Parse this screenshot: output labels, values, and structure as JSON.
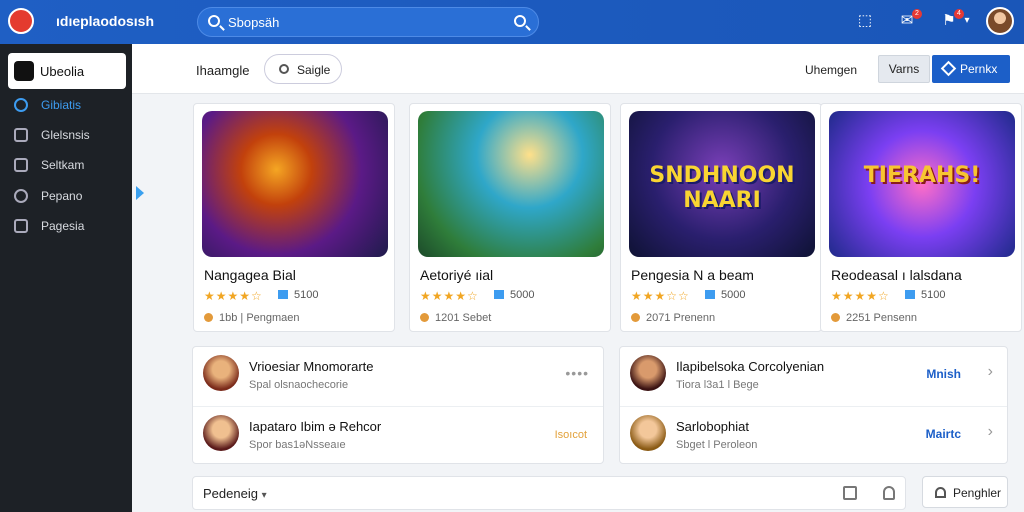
{
  "topbar": {
    "app_name": "ıdıeplaodosısh",
    "search_placeholder": "Sbopsäh",
    "notif_badge": "2",
    "notif_badge2": "4"
  },
  "sidebar": {
    "header_label": "Ubeolia",
    "items": [
      {
        "label": "Gibiatis",
        "icon": "search-icon"
      },
      {
        "label": "Glelsnsis",
        "icon": "person-icon"
      },
      {
        "label": "Seltkam",
        "icon": "image-icon"
      },
      {
        "label": "Pepano",
        "icon": "clock-icon"
      },
      {
        "label": "Pagesia",
        "icon": "calendar-icon"
      }
    ]
  },
  "subbar": {
    "title": "Ihaamgle",
    "pill": "Saigle",
    "right_label": "Uhemgen",
    "btn_secondary": "Varns",
    "btn_primary": "Pernkx"
  },
  "cards": [
    {
      "name": "Nangagea Bial",
      "stars": "★★★★☆",
      "downloads": "5100",
      "meta": "1bb | Pengmaen",
      "art_text": ""
    },
    {
      "name": "Aetoriyé ıial",
      "stars": "★★★★☆",
      "downloads": "5000",
      "meta": "1201 Sebet",
      "art_text": ""
    },
    {
      "name": "Pengesia N a beam",
      "stars": "★★★☆☆",
      "downloads": "5000",
      "meta": "2071 Prenenn",
      "art_text": "SNDHNOON NAARI"
    },
    {
      "name": "Reodeasal ı lalsdana",
      "stars": "★★★★☆",
      "downloads": "5100",
      "meta": "2251 Pensenn",
      "art_text": "TIERAHS!"
    }
  ],
  "list_left": [
    {
      "title": "Vrioesiar Mnomorarte",
      "sub": "Spal olsnaochecorie",
      "trail": "••••"
    },
    {
      "title": "Iapataro Ibim ǝ Rehcor",
      "sub": "Spor bas1ǝNsseaıe",
      "trail": "Isoıcot"
    }
  ],
  "list_right": [
    {
      "title": "Ilapibelsoka Corcolyenian",
      "sub": "Tiora l3a1 l Bege",
      "link": "Mnish"
    },
    {
      "title": "Sarlobophiat",
      "sub": "Sbget l Peroleon",
      "link": "Mairtc"
    }
  ],
  "bottom": {
    "dropdown": "Pedeneig",
    "button": "Penghler"
  }
}
